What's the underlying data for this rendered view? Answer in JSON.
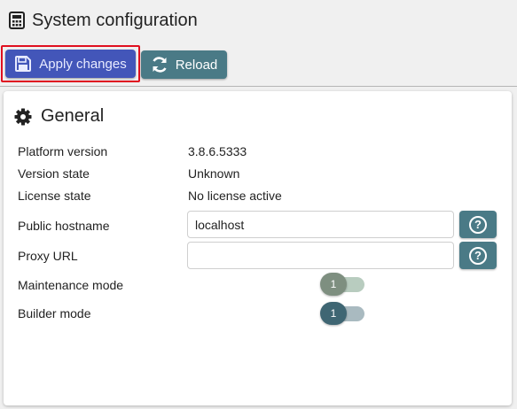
{
  "header": {
    "icon": "calculator-icon",
    "title": "System configuration"
  },
  "toolbar": {
    "apply_label": "Apply changes",
    "apply_icon": "save-icon",
    "reload_label": "Reload",
    "reload_icon": "refresh-icon",
    "colors": {
      "apply": "#4356b9",
      "reload": "#4a7a86",
      "highlight": "#e01020"
    }
  },
  "general": {
    "title": "General",
    "icon": "gear-icon",
    "platform_version": {
      "label": "Platform version",
      "value": "3.8.6.5333"
    },
    "version_state": {
      "label": "Version state",
      "value": "Unknown"
    },
    "license_state": {
      "label": "License state",
      "value": "No license active"
    },
    "public_hostname": {
      "label": "Public hostname",
      "value": "localhost"
    },
    "proxy_url": {
      "label": "Proxy URL",
      "value": ""
    },
    "maintenance_mode": {
      "label": "Maintenance mode",
      "value": "1"
    },
    "builder_mode": {
      "label": "Builder mode",
      "value": "1"
    }
  }
}
